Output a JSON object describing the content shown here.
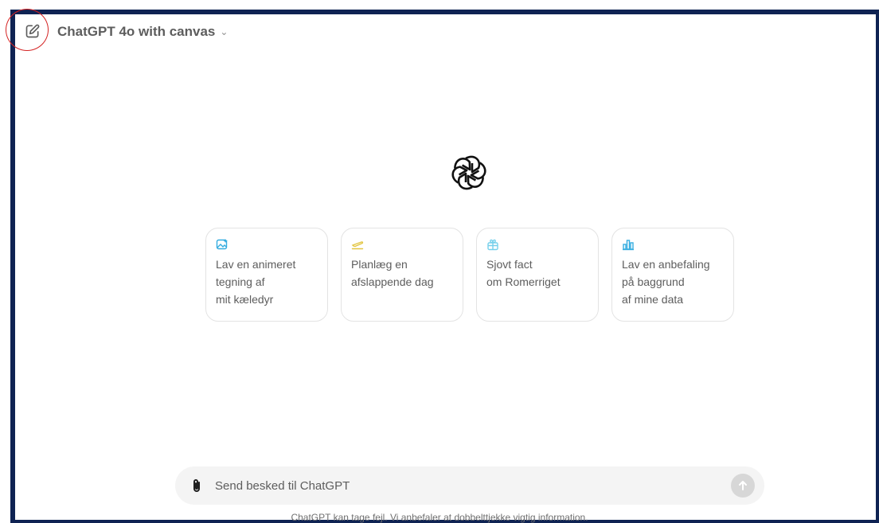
{
  "header": {
    "model_name": "ChatGPT 4o with canvas"
  },
  "suggestions": [
    {
      "icon": "image-icon",
      "color": "#35ade0",
      "text": "Lav en animeret\ntegning af\nmit kæledyr"
    },
    {
      "icon": "airplane-icon",
      "color": "#e2c541",
      "text": "Planlæg en\nafslappende dag"
    },
    {
      "icon": "gift-icon",
      "color": "#76d0eb",
      "text": "Sjovt fact\nom Romerriget"
    },
    {
      "icon": "bar-chart-icon",
      "color": "#35ade0",
      "text": "Lav en anbefaling\npå baggrund\naf mine data"
    }
  ],
  "composer": {
    "placeholder": "Send besked til ChatGPT"
  },
  "footer": {
    "disclaimer": "ChatGPT kan tage fejl. Vi anbefaler at dobbelttjekke vigtig information."
  },
  "colors": {
    "frame": "#0f2353",
    "highlight": "#d42323"
  }
}
